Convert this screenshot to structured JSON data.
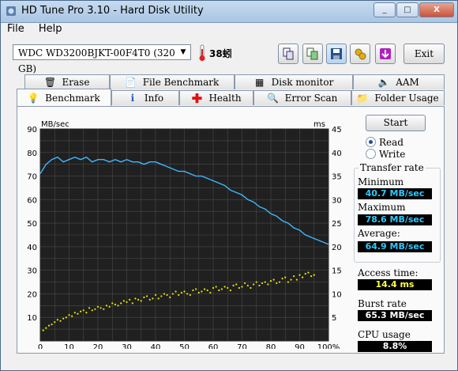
{
  "window": {
    "title": "HD Tune Pro 3.10 - Hard Disk Utility",
    "controls": [
      "_",
      "□",
      "X"
    ]
  },
  "menu": [
    "File",
    "Help"
  ],
  "toolbar": {
    "drive": "WDC WD3200BJKT-00F4T0 (320 GB)",
    "temperature": "38蚓",
    "exit_label": "Exit",
    "icons": [
      "copy-info-icon",
      "copy-screen-icon",
      "save-icon",
      "options-icon",
      "download-icon"
    ]
  },
  "tabs_top": [
    {
      "label": "Erase",
      "icon": "trash-icon"
    },
    {
      "label": "File Benchmark",
      "icon": "file-benchmark-icon"
    },
    {
      "label": "Disk monitor",
      "icon": "disk-monitor-icon"
    },
    {
      "label": "AAM",
      "icon": "speaker-icon"
    }
  ],
  "tabs_bottom": [
    {
      "label": "Benchmark",
      "icon": "bulb-icon",
      "active": true
    },
    {
      "label": "Info",
      "icon": "info-icon"
    },
    {
      "label": "Health",
      "icon": "health-cross-icon"
    },
    {
      "label": "Error Scan",
      "icon": "magnifier-icon"
    },
    {
      "label": "Folder Usage",
      "icon": "folder-icon"
    }
  ],
  "controls": {
    "start_label": "Start",
    "mode_options": [
      "Read",
      "Write"
    ],
    "mode_selected": "Read"
  },
  "stats": {
    "transfer_rate_title": "Transfer rate",
    "minimum_label": "Minimum",
    "minimum_value": "40.7 MB/sec",
    "maximum_label": "Maximum",
    "maximum_value": "78.6 MB/sec",
    "average_label": "Average:",
    "average_value": "64.9 MB/sec",
    "access_label": "Access time:",
    "access_value": "14.4 ms",
    "burst_label": "Burst rate",
    "burst_value": "65.3 MB/sec",
    "cpu_label": "CPU usage",
    "cpu_value": "8.8%"
  },
  "colors": {
    "transfer_line": "#3fb8ff",
    "access_points": "#e8e800",
    "plot_bg": "#202020",
    "grid": "#4a4a4a"
  },
  "chart_data": {
    "type": "line",
    "y_unit_left": "MB/sec",
    "y_unit_right": "ms",
    "x_ticks": [
      "0",
      "10",
      "20",
      "30",
      "40",
      "50",
      "60",
      "70",
      "80",
      "90",
      "100%"
    ],
    "y_left_ticks": [
      "10",
      "20",
      "30",
      "40",
      "50",
      "60",
      "70",
      "80",
      "90"
    ],
    "y_right_ticks": [
      "5",
      "10",
      "15",
      "20",
      "25",
      "30",
      "35",
      "40",
      "45"
    ],
    "xlim": [
      0,
      100
    ],
    "ylim_left": [
      0,
      90
    ],
    "ylim_right": [
      0,
      45
    ],
    "series": [
      {
        "kind": "transfer_rate",
        "x": [
          0,
          2,
          4,
          6,
          8,
          10,
          12,
          14,
          16,
          18,
          20,
          22,
          24,
          26,
          28,
          30,
          32,
          34,
          36,
          38,
          40,
          42,
          44,
          46,
          48,
          50,
          52,
          54,
          56,
          58,
          60,
          62,
          64,
          66,
          68,
          70,
          72,
          74,
          76,
          78,
          80,
          82,
          84,
          86,
          88,
          90,
          92,
          94,
          96,
          98,
          100
        ],
        "y": [
          71,
          75,
          77,
          78,
          76,
          77,
          78,
          77,
          78,
          76,
          77,
          77,
          76,
          77,
          76,
          77,
          76,
          76,
          75,
          76,
          76,
          75,
          74,
          73,
          72,
          72,
          71,
          70,
          70,
          69,
          68,
          67,
          66,
          64,
          63,
          62,
          60,
          59,
          57,
          56,
          54,
          53,
          51,
          50,
          48,
          47,
          45,
          44,
          43,
          42,
          41
        ]
      },
      {
        "kind": "access_time_scatter",
        "x": [
          1,
          2,
          3,
          4,
          5,
          6,
          7,
          8,
          9,
          10,
          11,
          12,
          13,
          14,
          15,
          16,
          17,
          18,
          19,
          20,
          21,
          22,
          23,
          24,
          25,
          26,
          27,
          28,
          29,
          30,
          31,
          32,
          33,
          34,
          35,
          36,
          37,
          38,
          39,
          40,
          41,
          42,
          43,
          44,
          45,
          46,
          47,
          48,
          49,
          50,
          51,
          52,
          53,
          54,
          55,
          56,
          57,
          58,
          59,
          60,
          61,
          62,
          63,
          64,
          65,
          66,
          67,
          68,
          69,
          70,
          71,
          72,
          73,
          74,
          75,
          76,
          77,
          78,
          79,
          80,
          81,
          82,
          83,
          84,
          85,
          86,
          87,
          88,
          89,
          90,
          91,
          92,
          93,
          94,
          95
        ],
        "y": [
          4.5,
          5.5,
          6.5,
          7,
          8,
          9,
          8.5,
          9.5,
          10,
          11,
          10.5,
          12,
          11.5,
          12.5,
          13,
          12,
          14,
          13,
          13.5,
          14.5,
          14,
          13.5,
          15,
          14.5,
          16,
          15.5,
          15,
          16,
          17,
          16.5,
          17.5,
          16,
          18,
          17.5,
          17,
          18.5,
          19,
          17.5,
          18,
          19.5,
          18,
          19,
          20,
          19.5,
          18.5,
          20,
          21,
          19.5,
          20.5,
          21,
          20,
          19.5,
          21.5,
          22,
          20.5,
          21,
          22,
          21.5,
          20.5,
          22.5,
          23,
          21.5,
          22,
          23,
          22.5,
          21.5,
          23.5,
          24,
          22.5,
          23,
          24.5,
          23.5,
          22.5,
          24,
          25,
          23.5,
          24.5,
          25,
          24,
          25.5,
          26,
          24.5,
          25,
          26.5,
          27,
          25,
          26,
          27.5,
          26,
          28,
          27,
          28.5,
          29,
          27.5,
          28
        ]
      }
    ]
  }
}
